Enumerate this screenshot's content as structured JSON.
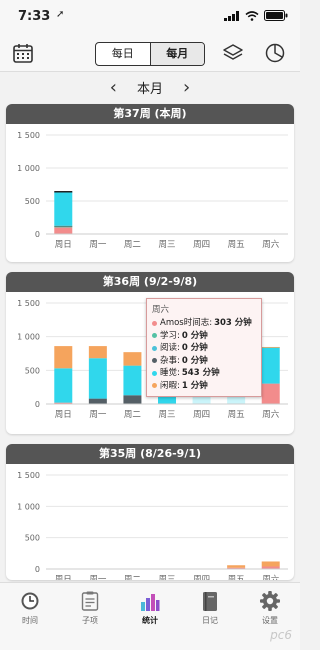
{
  "status": {
    "time": "7:33",
    "location_glyph": "➚"
  },
  "toolbar": {
    "seg_daily": "每日",
    "seg_weekly": "每月"
  },
  "month_nav": {
    "label": "本月",
    "prev": "‹",
    "next": "›"
  },
  "colors": {
    "amos": "#f28c8c",
    "study": "#54c1a4",
    "read": "#4cc1d8",
    "misc": "#555f66",
    "sleep": "#30d7ec",
    "leisure": "#f5a45d"
  },
  "days": [
    "周日",
    "周一",
    "周二",
    "周三",
    "周四",
    "周五",
    "周六"
  ],
  "y_ticks": [
    "1 500",
    "1 000",
    "500",
    "0"
  ],
  "cards": [
    {
      "title": "第37周 (本周)"
    },
    {
      "title": "第36周 (9/2-9/8)"
    },
    {
      "title": "第35周 (8/26-9/1)"
    }
  ],
  "chart_data": [
    {
      "type": "bar",
      "title": "第37周 (本周)",
      "ylim": [
        0,
        1500
      ],
      "stacked": true,
      "categories": [
        "周日",
        "周一",
        "周二",
        "周三",
        "周四",
        "周五",
        "周六"
      ],
      "series": [
        {
          "name": "Amos时间志",
          "values": [
            100,
            0,
            0,
            0,
            0,
            0,
            0
          ]
        },
        {
          "name": "学习",
          "values": [
            20,
            0,
            0,
            0,
            0,
            0,
            0
          ]
        },
        {
          "name": "阅读",
          "values": [
            0,
            0,
            0,
            0,
            0,
            0,
            0
          ]
        },
        {
          "name": "杂事",
          "values": [
            5,
            0,
            0,
            0,
            0,
            0,
            0
          ]
        },
        {
          "name": "睡觉",
          "values": [
            515,
            0,
            0,
            0,
            0,
            0,
            0
          ]
        },
        {
          "name": "闲暇",
          "values": [
            0,
            0,
            0,
            0,
            0,
            0,
            0
          ]
        }
      ]
    },
    {
      "type": "bar",
      "title": "第36周 (9/2-9/8)",
      "ylim": [
        0,
        1500
      ],
      "stacked": true,
      "categories": [
        "周日",
        "周一",
        "周二",
        "周三",
        "周四",
        "周五",
        "周六"
      ],
      "series": [
        {
          "name": "Amos时间志",
          "values": [
            20,
            0,
            0,
            0,
            0,
            0,
            303
          ]
        },
        {
          "name": "学习",
          "values": [
            0,
            0,
            0,
            0,
            0,
            0,
            0
          ]
        },
        {
          "name": "阅读",
          "values": [
            0,
            0,
            0,
            0,
            0,
            0,
            0
          ]
        },
        {
          "name": "杂事",
          "values": [
            0,
            80,
            130,
            0,
            0,
            0,
            0
          ]
        },
        {
          "name": "睡觉",
          "values": [
            510,
            600,
            440,
            500,
            560,
            510,
            543
          ]
        },
        {
          "name": "闲暇",
          "values": [
            330,
            180,
            200,
            80,
            60,
            90,
            1
          ]
        }
      ]
    },
    {
      "type": "bar",
      "title": "第35周 (8/26-9/1)",
      "ylim": [
        0,
        1500
      ],
      "stacked": true,
      "categories": [
        "周日",
        "周一",
        "周二",
        "周三",
        "周四",
        "周五",
        "周六"
      ],
      "series": [
        {
          "name": "Amos时间志",
          "values": [
            0,
            0,
            0,
            0,
            0,
            20,
            40
          ]
        },
        {
          "name": "学习",
          "values": [
            0,
            0,
            0,
            0,
            0,
            0,
            0
          ]
        },
        {
          "name": "阅读",
          "values": [
            0,
            0,
            0,
            0,
            0,
            0,
            0
          ]
        },
        {
          "name": "杂事",
          "values": [
            0,
            0,
            0,
            0,
            0,
            0,
            0
          ]
        },
        {
          "name": "睡觉",
          "values": [
            0,
            0,
            0,
            0,
            0,
            0,
            0
          ]
        },
        {
          "name": "闲暇",
          "values": [
            0,
            0,
            0,
            0,
            0,
            40,
            80
          ]
        }
      ]
    }
  ],
  "tooltip": {
    "title": "周六",
    "rows": [
      {
        "label": "Amos时间志:",
        "value": "303 分钟"
      },
      {
        "label": "学习:",
        "value": "0 分钟"
      },
      {
        "label": "阅读:",
        "value": "0 分钟"
      },
      {
        "label": "杂事:",
        "value": "0 分钟"
      },
      {
        "label": "睡觉:",
        "value": "543 分钟"
      },
      {
        "label": "闲暇:",
        "value": "1 分钟"
      }
    ]
  },
  "tabs": [
    {
      "label": "时间",
      "icon": "clock-icon"
    },
    {
      "label": "子项",
      "icon": "list-icon"
    },
    {
      "label": "统计",
      "icon": "bar-chart-icon"
    },
    {
      "label": "日记",
      "icon": "diary-icon"
    },
    {
      "label": "设置",
      "icon": "gear-icon"
    }
  ],
  "watermark": "pc6"
}
